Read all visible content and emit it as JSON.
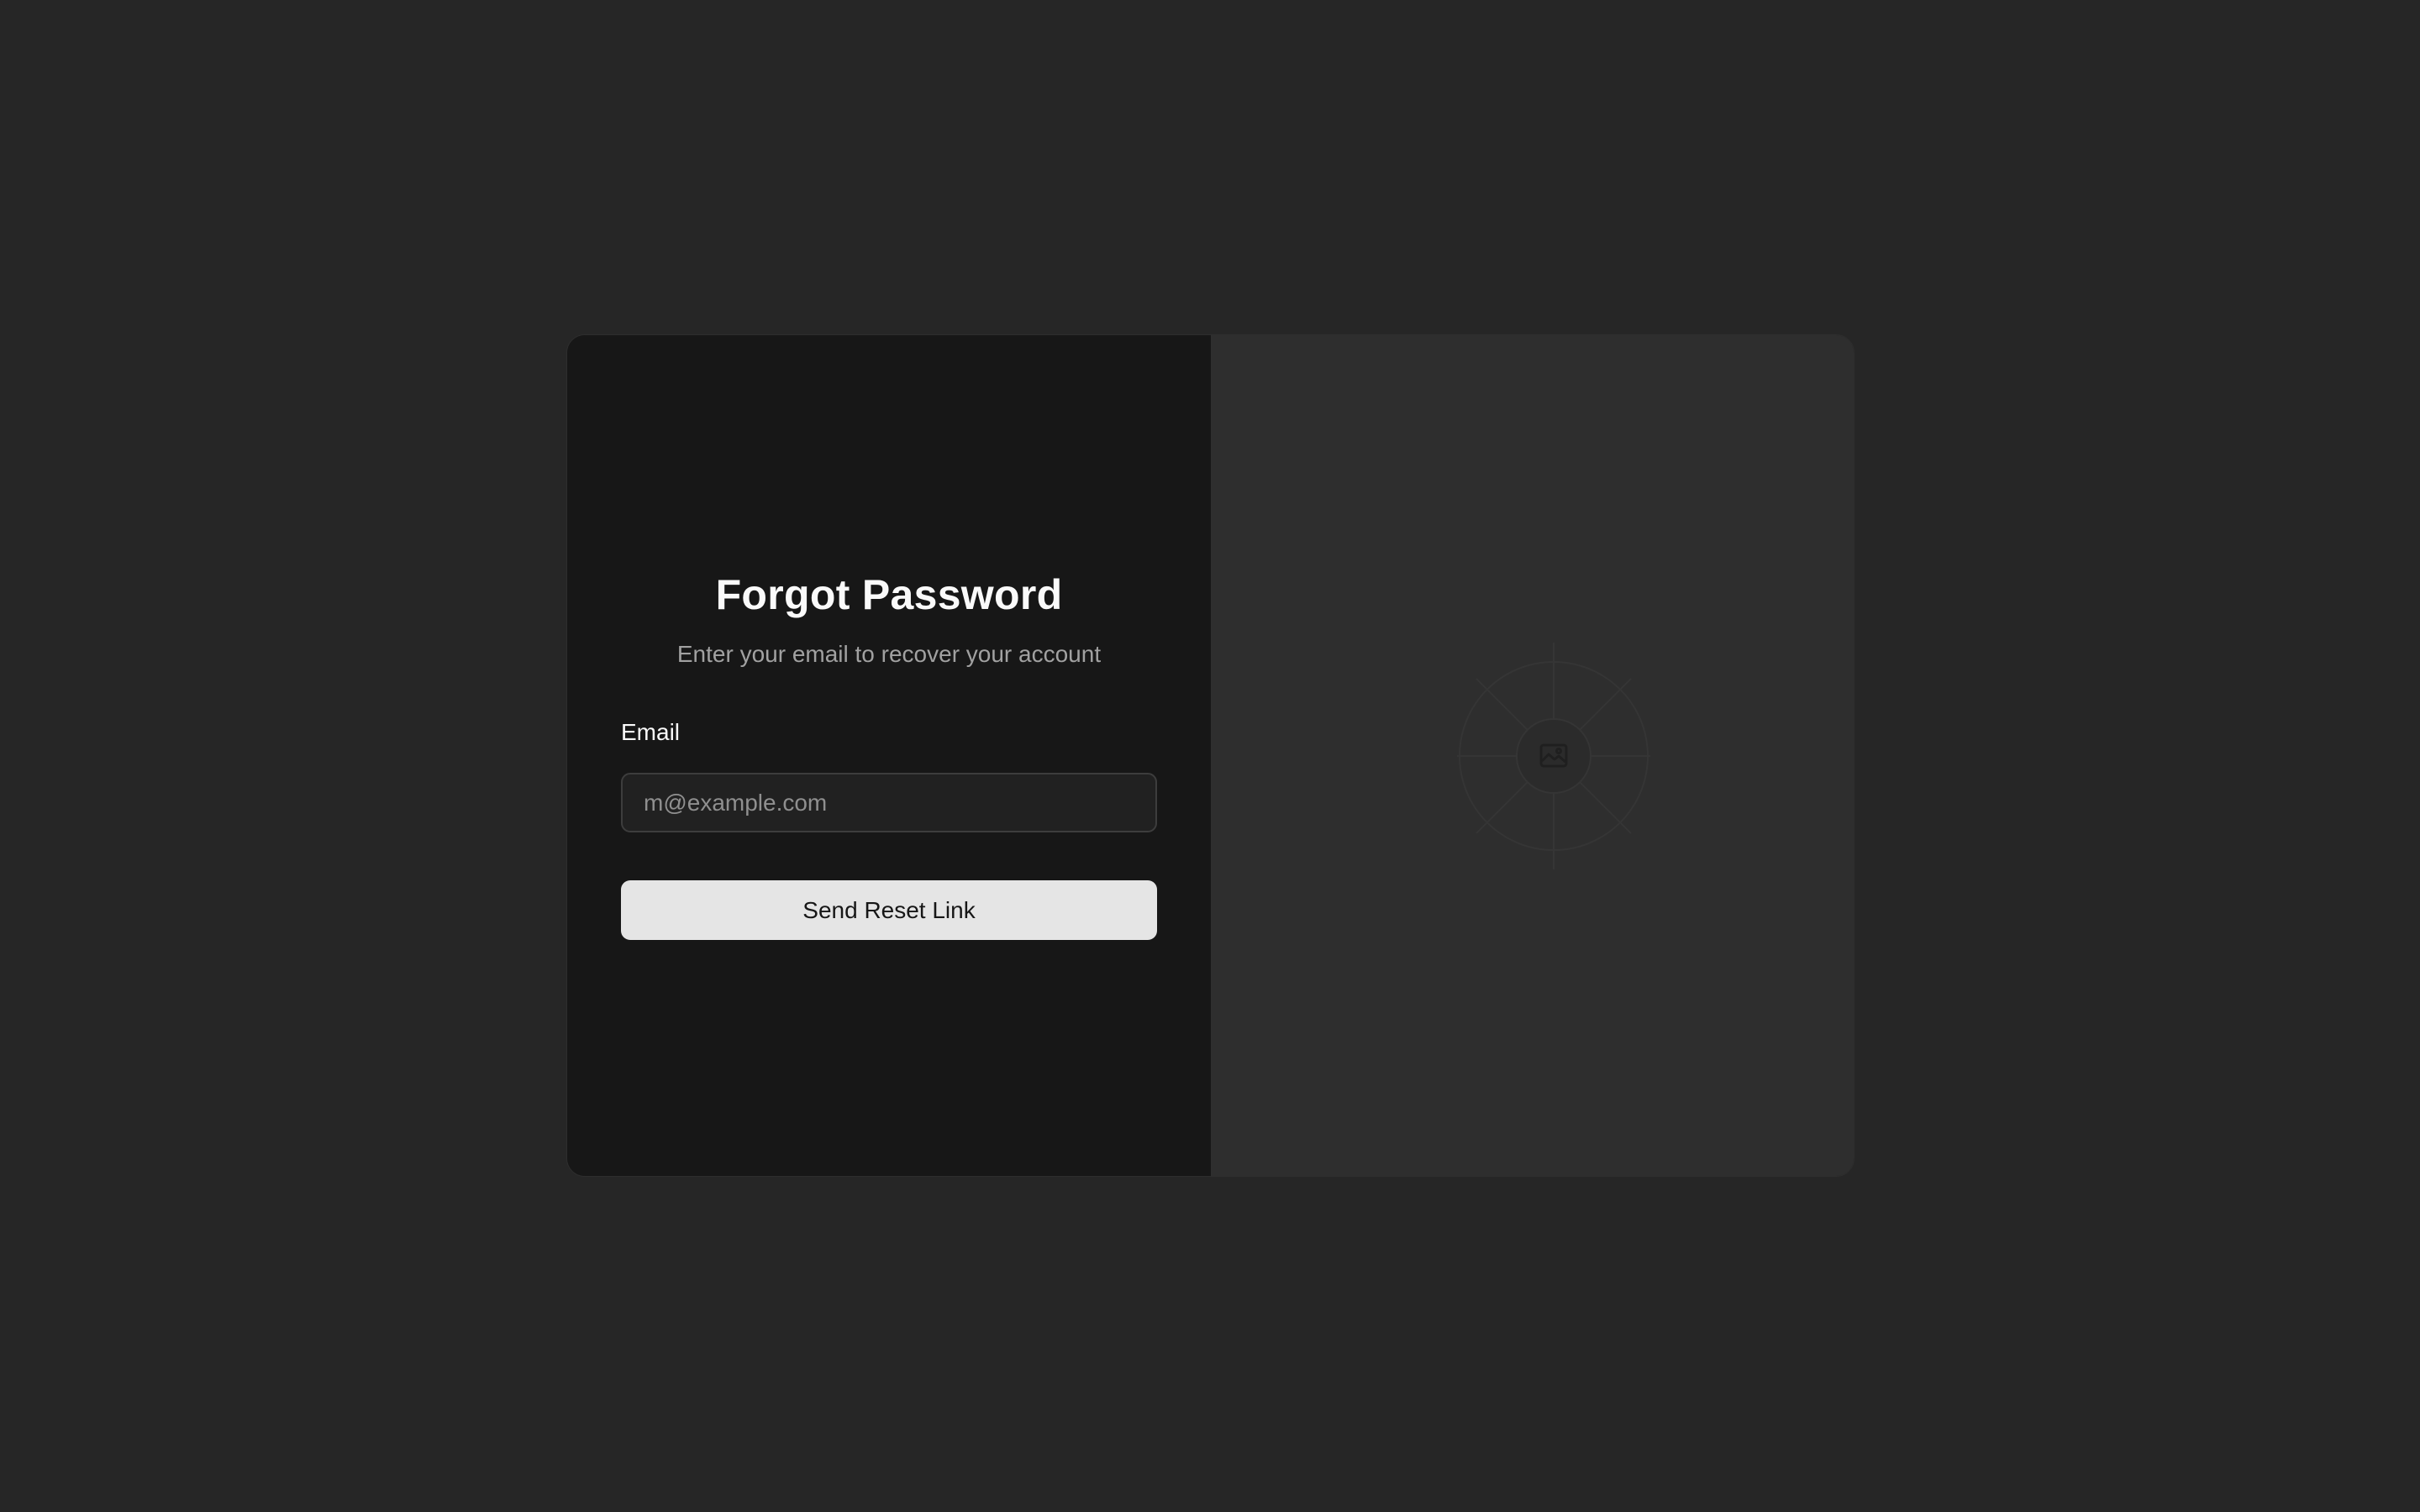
{
  "form": {
    "title": "Forgot Password",
    "subtitle": "Enter your email to recover your account",
    "email_label": "Email",
    "email_placeholder": "m@example.com",
    "email_value": "",
    "submit_label": "Send Reset Link"
  },
  "media": {
    "icon": "image-placeholder-icon"
  },
  "colors": {
    "page_background": "#262626",
    "form_panel": "#171717",
    "media_panel": "#2e2e2e",
    "button": "#e5e5e5"
  }
}
